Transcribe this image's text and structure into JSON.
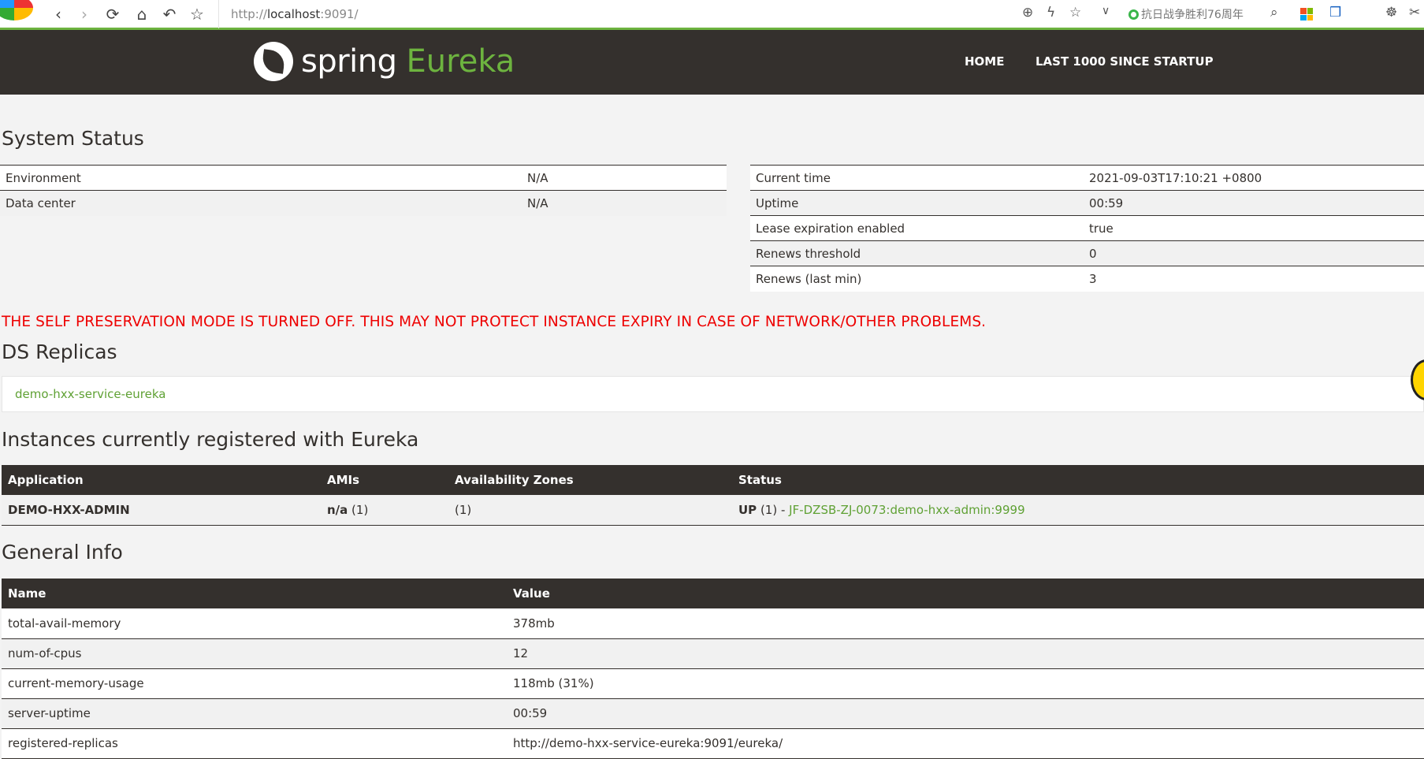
{
  "browser": {
    "url_prefix": "http://",
    "url_host": "localhost",
    "url_suffix": ":9091/",
    "news_text": "抗日战争胜利76周年"
  },
  "header": {
    "brand_spring": "spring",
    "brand_eureka": "Eureka",
    "nav_home": "HOME",
    "nav_last1000": "LAST 1000 SINCE STARTUP"
  },
  "system_status": {
    "title": "System Status",
    "left": [
      {
        "label": "Environment",
        "value": "N/A"
      },
      {
        "label": "Data center",
        "value": "N/A"
      }
    ],
    "right": [
      {
        "label": "Current time",
        "value": "2021-09-03T17:10:21 +0800"
      },
      {
        "label": "Uptime",
        "value": "00:59"
      },
      {
        "label": "Lease expiration enabled",
        "value": "true"
      },
      {
        "label": "Renews threshold",
        "value": "0"
      },
      {
        "label": "Renews (last min)",
        "value": "3"
      }
    ]
  },
  "warning": "THE SELF PRESERVATION MODE IS TURNED OFF. THIS MAY NOT PROTECT INSTANCE EXPIRY IN CASE OF NETWORK/OTHER PROBLEMS.",
  "ds_replicas": {
    "title": "DS Replicas",
    "items": [
      "demo-hxx-service-eureka"
    ]
  },
  "instances": {
    "title": "Instances currently registered with Eureka",
    "headers": [
      "Application",
      "AMIs",
      "Availability Zones",
      "Status"
    ],
    "rows": [
      {
        "application": "DEMO-HXX-ADMIN",
        "ami_bold": "n/a",
        "ami_count": " (1)",
        "zones": "(1)",
        "status_bold": "UP",
        "status_count": " (1) - ",
        "status_link": "JF-DZSB-ZJ-0073:demo-hxx-admin:9999"
      }
    ]
  },
  "general_info": {
    "title": "General Info",
    "headers": [
      "Name",
      "Value"
    ],
    "rows": [
      {
        "name": "total-avail-memory",
        "value": "378mb"
      },
      {
        "name": "num-of-cpus",
        "value": "12"
      },
      {
        "name": "current-memory-usage",
        "value": "118mb (31%)"
      },
      {
        "name": "server-uptime",
        "value": "00:59"
      },
      {
        "name": "registered-replicas",
        "value": "http://demo-hxx-service-eureka:9091/eureka/"
      }
    ]
  },
  "colors": {
    "brand_green": "#6db33f",
    "header_dark": "#34302d",
    "warning_red": "#e00000",
    "link_green": "#5fa134"
  }
}
